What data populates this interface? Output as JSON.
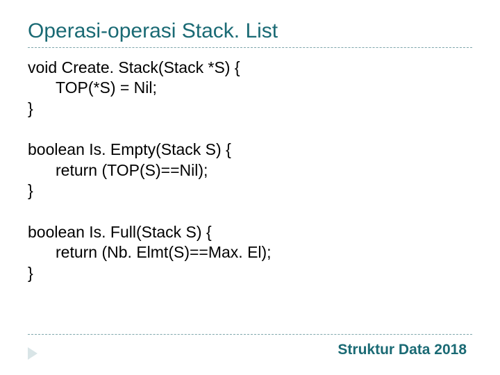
{
  "title": "Operasi-operasi Stack. List",
  "blocks": [
    {
      "line1": "void Create. Stack(Stack *S) {",
      "line2": "TOP(*S) = Nil;",
      "line3": "}"
    },
    {
      "line1": "boolean Is. Empty(Stack S) {",
      "line2": "return (TOP(S)==Nil);",
      "line3": "}"
    },
    {
      "line1": "boolean Is. Full(Stack S) {",
      "line2": "return (Nb. Elmt(S)==Max. El);",
      "line3": "}"
    }
  ],
  "footer": "Struktur Data 2018"
}
